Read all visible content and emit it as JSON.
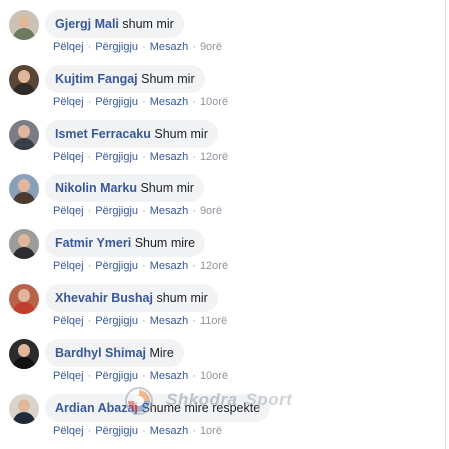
{
  "comments": [
    {
      "author": "Gjergj Mali",
      "text": "shum mir",
      "like": "Pëlqej",
      "reply": "Përgjigju",
      "message": "Mesazh",
      "time": "9orë",
      "avatar_color": "#c9c3b6",
      "shirt_color": "#6d7a61"
    },
    {
      "author": "Kujtim Fangaj",
      "text": "Shum mir",
      "like": "Pëlqej",
      "reply": "Përgjigju",
      "message": "Mesazh",
      "time": "10orë",
      "avatar_color": "#5a4635",
      "shirt_color": "#2f2a26"
    },
    {
      "author": "Ismet Ferracaku",
      "text": "Shum mir",
      "like": "Pëlqej",
      "reply": "Përgjigju",
      "message": "Mesazh",
      "time": "12orë",
      "avatar_color": "#7a7d83",
      "shirt_color": "#3a3f47"
    },
    {
      "author": "Nikolin Marku",
      "text": "Shum mir",
      "like": "Pëlqej",
      "reply": "Përgjigju",
      "message": "Mesazh",
      "time": "9orë",
      "avatar_color": "#8aa0b8",
      "shirt_color": "#4a3b30"
    },
    {
      "author": "Fatmir Ymeri",
      "text": "Shum mire",
      "like": "Pëlqej",
      "reply": "Përgjigju",
      "message": "Mesazh",
      "time": "12orë",
      "avatar_color": "#9b9d98",
      "shirt_color": "#2c2d30"
    },
    {
      "author": "Xhevahir Bushaj",
      "text": "shum mir",
      "like": "Pëlqej",
      "reply": "Përgjigju",
      "message": "Mesazh",
      "time": "11orë",
      "avatar_color": "#b8644a",
      "shirt_color": "#c23e2c"
    },
    {
      "author": "Bardhyl Shimaj",
      "text": "Mire",
      "like": "Pëlqej",
      "reply": "Përgjigju",
      "message": "Mesazh",
      "time": "10orë",
      "avatar_color": "#2b2b2b",
      "shirt_color": "#111111"
    },
    {
      "author": "Ardian Abazaj",
      "text": "Shume mire respekte",
      "like": "Pëlqej",
      "reply": "Përgjigju",
      "message": "Mesazh",
      "time": "1orë",
      "avatar_color": "#d9d4cc",
      "shirt_color": "#1f2a3a"
    }
  ],
  "watermark": {
    "brand": "Shkodra",
    "suffix": "Sport"
  },
  "colors": {
    "link": "#385898",
    "meta": "#90949c",
    "bubble": "#f2f3f5",
    "text": "#1c1e21"
  }
}
